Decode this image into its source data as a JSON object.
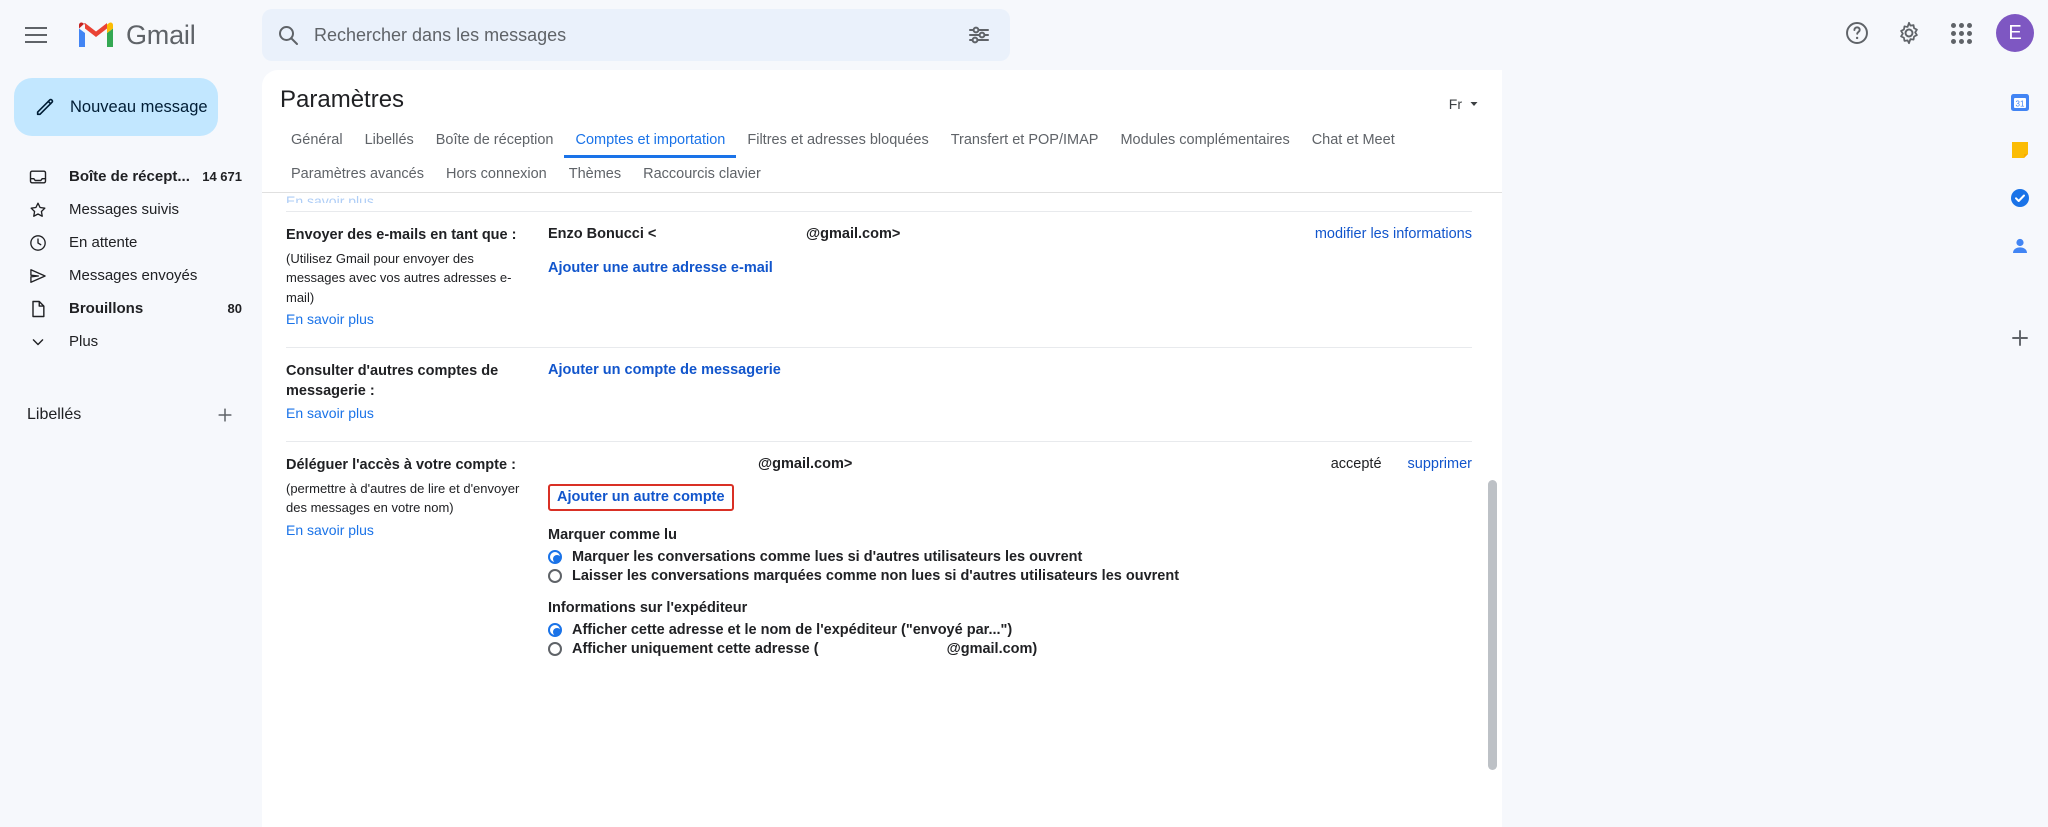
{
  "app": {
    "brand": "Gmail",
    "avatar_initial": "E"
  },
  "search": {
    "placeholder": "Rechercher dans les messages",
    "value": ""
  },
  "sidebar": {
    "compose_label": "Nouveau message",
    "items": [
      {
        "label": "Boîte de récept...",
        "count": "14 671",
        "icon": "inbox-icon"
      },
      {
        "label": "Messages suivis",
        "count": "",
        "icon": "star-icon"
      },
      {
        "label": "En attente",
        "count": "",
        "icon": "clock-icon"
      },
      {
        "label": "Messages envoyés",
        "count": "",
        "icon": "send-icon"
      },
      {
        "label": "Brouillons",
        "count": "80",
        "icon": "draft-icon"
      },
      {
        "label": "Plus",
        "count": "",
        "icon": "chevron-down-icon"
      }
    ],
    "labels_header": "Libellés"
  },
  "settings": {
    "title": "Paramètres",
    "language_button": "Fr",
    "tabs_row1": [
      "Général",
      "Libellés",
      "Boîte de réception",
      "Comptes et importation",
      "Filtres et adresses bloquées",
      "Transfert et POP/IMAP",
      "Modules complémentaires",
      "Chat et Meet"
    ],
    "tabs_row2": [
      "Paramètres avancés",
      "Hors connexion",
      "Thèmes",
      "Raccourcis clavier"
    ],
    "active_tab": "Comptes et importation",
    "partial_top_link": "En savoir plus"
  },
  "send_as": {
    "label": "Envoyer des e-mails en tant que :",
    "note": "(Utilisez Gmail pour envoyer des messages avec vos autres adresses e-mail)",
    "learn_more": "En savoir plus",
    "account_name": "Enzo Bonucci <",
    "account_mail": "@gmail.com>",
    "edit_link": "modifier les informations",
    "add_link": "Ajouter une autre adresse e-mail"
  },
  "check_mail": {
    "label": "Consulter d'autres comptes de messagerie :",
    "learn_more": "En savoir plus",
    "add_link": "Ajouter un compte de messagerie"
  },
  "delegation": {
    "label": "Déléguer l'accès à votre compte :",
    "note": "(permettre à d'autres de lire et d'envoyer des messages en votre nom)",
    "learn_more": "En savoir plus",
    "delegate_mail": "@gmail.com>",
    "status": "accepté",
    "remove_link": "supprimer",
    "add_link": "Ajouter un autre compte",
    "mark_as_read": {
      "title": "Marquer comme lu",
      "options": [
        {
          "label": "Marquer les conversations comme lues si d'autres utilisateurs les ouvrent",
          "selected": true
        },
        {
          "label": "Laisser les conversations marquées comme non lues si d'autres utilisateurs les ouvrent",
          "selected": false
        }
      ]
    },
    "sender_info": {
      "title": "Informations sur l'expéditeur",
      "options": [
        {
          "label": "Afficher cette adresse et le nom de l'expéditeur (\"envoyé par...\")",
          "selected": true
        },
        {
          "label": "Afficher uniquement cette adresse (",
          "suffix": "@gmail.com)",
          "selected": false
        }
      ]
    }
  },
  "colors": {
    "accent": "#1a73e8",
    "highlight": "#d93025",
    "compose_bg": "#C2E7FF"
  }
}
